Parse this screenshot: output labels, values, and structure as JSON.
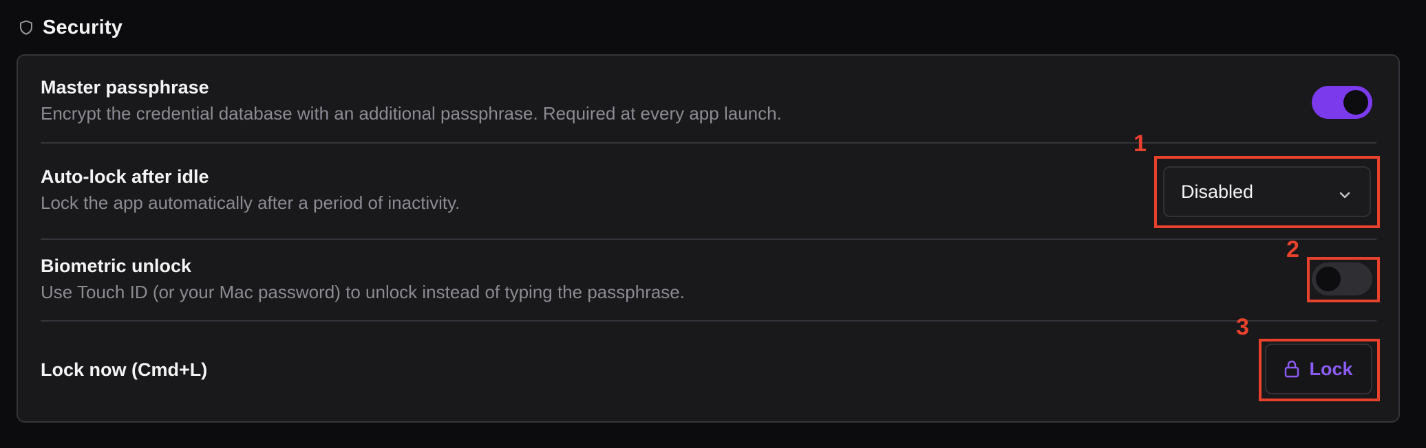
{
  "section": {
    "title": "Security",
    "icon": "shield-icon"
  },
  "settings": {
    "master_passphrase": {
      "title": "Master passphrase",
      "description": "Encrypt the credential database with an additional passphrase. Required at every app launch.",
      "enabled": true
    },
    "auto_lock": {
      "title": "Auto-lock after idle",
      "description": "Lock the app automatically after a period of inactivity.",
      "selected_value": "Disabled"
    },
    "biometric": {
      "title": "Biometric unlock",
      "description": "Use Touch ID (or your Mac password) to unlock instead of typing the passphrase.",
      "enabled": false
    },
    "lock_now": {
      "title": "Lock now (Cmd+L)",
      "button_label": "Lock",
      "button_icon": "lock-icon"
    }
  },
  "annotations": {
    "one": "1",
    "two": "2",
    "three": "3"
  },
  "colors": {
    "accent": "#7c3aed",
    "accent_text": "#8b5cf6",
    "annotation": "#e8412c",
    "background": "#0c0c0e",
    "card": "#19191b"
  }
}
